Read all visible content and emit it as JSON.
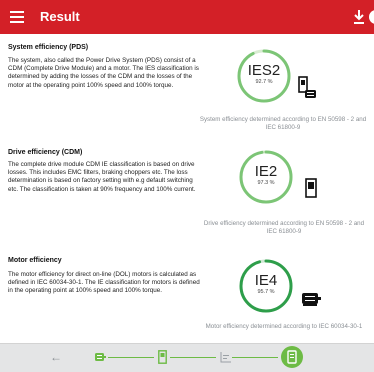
{
  "app": {
    "title": "Result"
  },
  "sections": [
    {
      "title": "System efficiency (PDS)",
      "body": "The system, also called the Power Drive System (PDS) consist of a CDM (Complete Drive Module) and a motor. The IES classification is determined by adding the losses of the CDM and the losses of the motor at the operating point 100% speed and 100% torque.",
      "class": "IES2",
      "percent_label": "92.7 %",
      "percent": 92.7,
      "caption": "System efficiency determined according to EN 50598 - 2 and IEC 61800-9",
      "device_icon": "drive-and-motor-icon"
    },
    {
      "title": "Drive efficiency (CDM)",
      "body": "The complete drive module CDM IE classification is based on drive losses. This includes EMC filters, braking choppers etc. The loss determination is based on factory setting with e.g default switching etc. The classification is taken at 90% frequency and 100% current.",
      "class": "IE2",
      "percent_label": "97.3 %",
      "percent": 97.3,
      "caption": "Drive efficiency determined according to EN 50598 - 2 and IEC 61800-9",
      "device_icon": "drive-icon"
    },
    {
      "title": "Motor efficiency",
      "body": "The motor efficiency for direct on-line (DOL) motors is calculated as defined in IEC 60034-30-1. The IE classification for motors is defined in the operating point at 100% speed and 100% torque.",
      "class": "IE4",
      "percent_label": "95.7 %",
      "percent": 95.7,
      "caption": "Motor efficiency determined according to IEC 60034-30-1",
      "device_icon": "motor-icon"
    }
  ],
  "bottom_nav": {
    "back_label": "←",
    "steps": [
      {
        "icon": "motor-step-icon",
        "active": false
      },
      {
        "icon": "drive-step-icon",
        "active": false
      },
      {
        "icon": "load-profile-step-icon",
        "active": false
      },
      {
        "icon": "result-step-icon",
        "active": true
      }
    ]
  },
  "colors": {
    "accent": "#d32027",
    "ring_light": "#7cc576",
    "ring_dark": "#2e9e4a",
    "step_green": "#6dbb45"
  }
}
